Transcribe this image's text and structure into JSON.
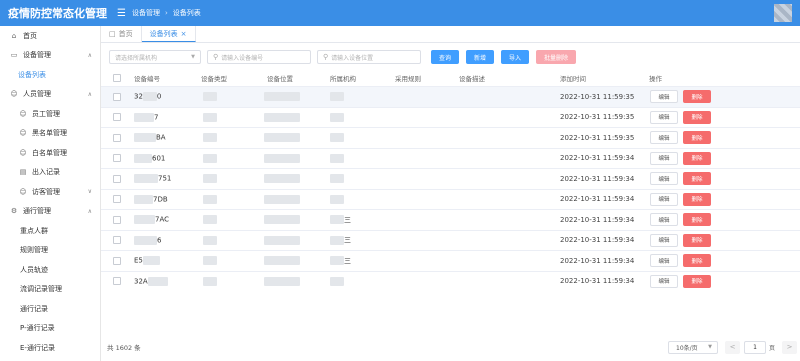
{
  "app": {
    "title": "疫情防控常态化管理"
  },
  "breadcrumb": [
    "设备管理",
    "设备列表"
  ],
  "sidebar": {
    "items": [
      {
        "label": "首页",
        "icon": "home-icon",
        "level": 0,
        "expandable": false,
        "active": false
      },
      {
        "label": "设备管理",
        "icon": "video-camera-icon",
        "level": 0,
        "expandable": true,
        "active": false
      },
      {
        "label": "设备列表",
        "icon": "",
        "level": 1,
        "expandable": false,
        "active": true
      },
      {
        "label": "人员管理",
        "icon": "user-icon",
        "level": 0,
        "expandable": true,
        "active": false
      },
      {
        "label": "员工管理",
        "icon": "user-icon",
        "level": 1,
        "expandable": false,
        "active": false
      },
      {
        "label": "黑名单管理",
        "icon": "user-icon",
        "level": 1,
        "expandable": false,
        "active": false
      },
      {
        "label": "白名单管理",
        "icon": "user-icon",
        "level": 1,
        "expandable": false,
        "active": false
      },
      {
        "label": "出入记录",
        "icon": "file-icon",
        "level": 1,
        "expandable": false,
        "active": false
      },
      {
        "label": "访客管理",
        "icon": "user-icon",
        "level": 1,
        "expandable": true,
        "active": false
      },
      {
        "label": "通行管理",
        "icon": "settings-icon",
        "level": 0,
        "expandable": true,
        "active": false
      },
      {
        "label": "重点人群",
        "icon": "",
        "level": 2,
        "expandable": false,
        "active": false
      },
      {
        "label": "规则管理",
        "icon": "",
        "level": 2,
        "expandable": false,
        "active": false
      },
      {
        "label": "人员轨迹",
        "icon": "",
        "level": 2,
        "expandable": false,
        "active": false
      },
      {
        "label": "流调记录管理",
        "icon": "",
        "level": 2,
        "expandable": false,
        "active": false
      },
      {
        "label": "通行记录",
        "icon": "",
        "level": 2,
        "expandable": false,
        "active": false
      },
      {
        "label": "P-通行记录",
        "icon": "",
        "level": 2,
        "expandable": false,
        "active": false
      },
      {
        "label": "E-通行记录",
        "icon": "",
        "level": 2,
        "expandable": false,
        "active": false
      }
    ]
  },
  "tabs": [
    {
      "label": "首页",
      "active": false,
      "closable": false
    },
    {
      "label": "设备列表",
      "active": true,
      "closable": true
    }
  ],
  "filters": {
    "org_placeholder": "请选择所属机构",
    "code_placeholder": "请输入设备编号",
    "location_placeholder": "请输入设备位置",
    "query_label": "查询",
    "add_label": "新增",
    "import_label": "导入",
    "batch_delete_label": "批量删除"
  },
  "table": {
    "columns": [
      "设备编号",
      "设备类型",
      "设备位置",
      "所属机构",
      "采用规则",
      "设备描述",
      "添加时间",
      "操作"
    ],
    "rows": [
      {
        "code_visible": "32",
        "code_tail": "0",
        "type_tail": "",
        "org_tail": "",
        "time": "2022-10-31 11:59:35",
        "highlighted": true
      },
      {
        "code_visible": "",
        "code_tail": "7",
        "type_tail": "",
        "org_tail": "",
        "time": "2022-10-31 11:59:35",
        "highlighted": false
      },
      {
        "code_visible": "",
        "code_tail": "BA",
        "type_tail": "",
        "org_tail": "",
        "time": "2022-10-31 11:59:35",
        "highlighted": false
      },
      {
        "code_visible": "",
        "code_tail": "601",
        "type_tail": "",
        "org_tail": "",
        "time": "2022-10-31 11:59:34",
        "highlighted": false
      },
      {
        "code_visible": "",
        "code_tail": "751",
        "type_tail": "",
        "org_tail": "",
        "time": "2022-10-31 11:59:34",
        "highlighted": false
      },
      {
        "code_visible": "",
        "code_tail": "7DB",
        "type_tail": "",
        "org_tail": "",
        "time": "2022-10-31 11:59:34",
        "highlighted": false
      },
      {
        "code_visible": "",
        "code_tail": "7AC",
        "type_tail": "",
        "org_tail": "三",
        "time": "2022-10-31 11:59:34",
        "highlighted": false
      },
      {
        "code_visible": "",
        "code_tail": "6",
        "type_tail": "",
        "org_tail": "三",
        "time": "2022-10-31 11:59:34",
        "highlighted": false
      },
      {
        "code_visible": "E5",
        "code_tail": "",
        "type_tail": "",
        "org_tail": "三",
        "time": "2022-10-31 11:59:34",
        "highlighted": false
      },
      {
        "code_visible": "32A",
        "code_tail": "",
        "type_tail": "",
        "org_tail": "",
        "time": "2022-10-31 11:59:34",
        "highlighted": false
      }
    ],
    "edit_label": "编辑",
    "delete_label": "删除"
  },
  "pagination": {
    "total_text": "共 1602 条",
    "page_size": "10条/页",
    "prev": "<",
    "next": ">",
    "current_page": "1",
    "page_suffix": "页"
  },
  "colors": {
    "primary": "#3a8ee6",
    "danger": "#f56c6c",
    "batch_delete": "#f9a7ae"
  }
}
